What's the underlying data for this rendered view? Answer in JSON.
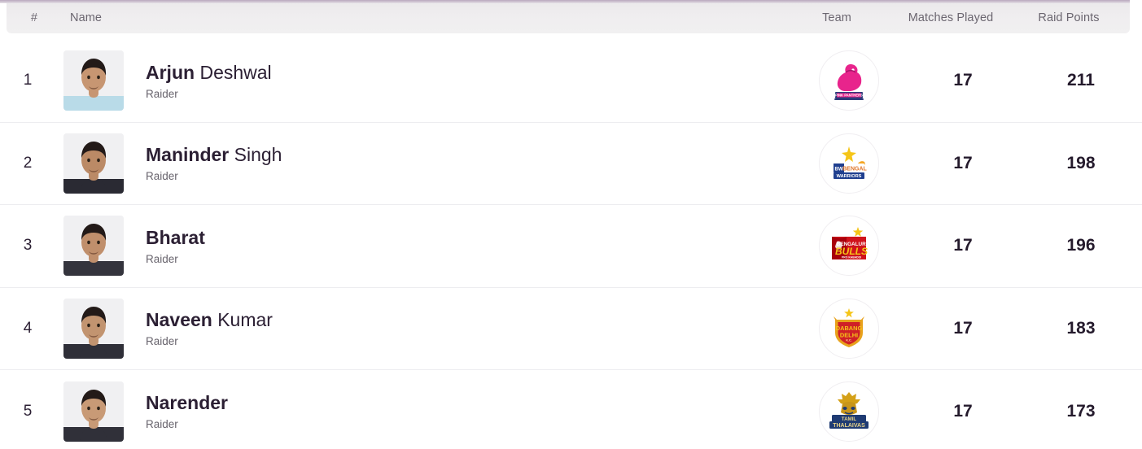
{
  "header": {
    "rank_label": "#",
    "name_label": "Name",
    "team_label": "Team",
    "matches_label": "Matches Played",
    "raid_points_label": "Raid Points"
  },
  "colors": {
    "accent": "#b9a8bd",
    "header_bg": "#efedef",
    "text_primary": "#2b1f33",
    "text_muted": "#67636c",
    "row_divider": "#ededf0"
  },
  "rows": [
    {
      "rank": "1",
      "first_name": "Arjun",
      "last_name": "Deshwal",
      "role": "Raider",
      "team": "Jaipur Pink Panthers",
      "team_icon": "jaipur-pink-panthers-logo",
      "matches_played": "17",
      "raid_points": "211",
      "photo_icon": "player-photo-arjun-deshwal"
    },
    {
      "rank": "2",
      "first_name": "Maninder",
      "last_name": "Singh",
      "role": "Raider",
      "team": "Bengal Warriors",
      "team_icon": "bengal-warriors-logo",
      "matches_played": "17",
      "raid_points": "198",
      "photo_icon": "player-photo-maninder-singh"
    },
    {
      "rank": "3",
      "first_name": "Bharat",
      "last_name": "",
      "role": "Raider",
      "team": "Bengaluru Bulls",
      "team_icon": "bengaluru-bulls-logo",
      "matches_played": "17",
      "raid_points": "196",
      "photo_icon": "player-photo-bharat"
    },
    {
      "rank": "4",
      "first_name": "Naveen",
      "last_name": "Kumar",
      "role": "Raider",
      "team": "Dabang Delhi",
      "team_icon": "dabang-delhi-logo",
      "matches_played": "17",
      "raid_points": "183",
      "photo_icon": "player-photo-naveen-kumar"
    },
    {
      "rank": "5",
      "first_name": "Narender",
      "last_name": "",
      "role": "Raider",
      "team": "Tamil Thalaivas",
      "team_icon": "tamil-thalaivas-logo",
      "matches_played": "17",
      "raid_points": "173",
      "photo_icon": "player-photo-narender"
    }
  ]
}
